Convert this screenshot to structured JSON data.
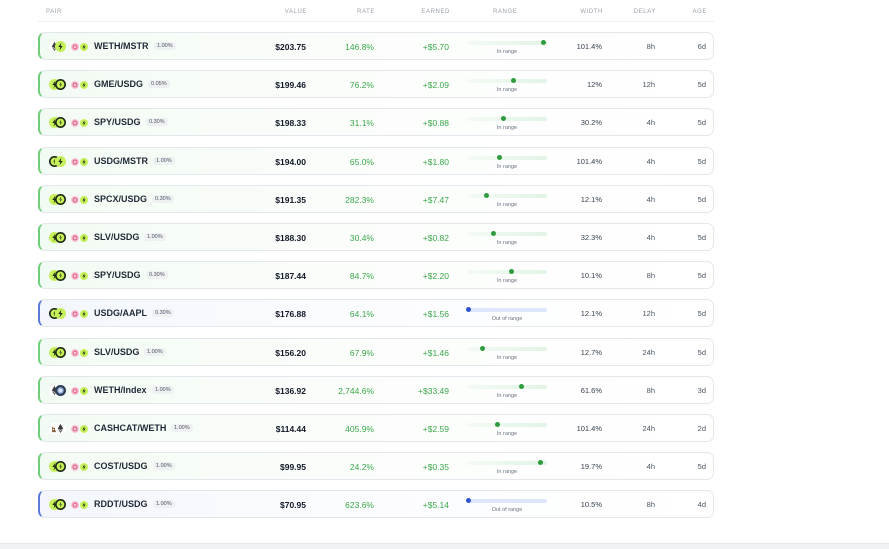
{
  "header": {
    "pair": "PAIR",
    "value": "VALUE",
    "rate": "RATE",
    "earned": "EARNED",
    "range": "RANGE",
    "width": "WIDTH",
    "delay": "DELAY",
    "age": "AGE"
  },
  "colors": {
    "positive": "#3aa84a",
    "in_range_dot": "#2e9b3e",
    "out_range_dot": "#2c55cf",
    "in_range_accent": "#6fcf7a",
    "out_range_accent": "#5b7bd6"
  },
  "positions": [
    {
      "pair": "WETH/MSTR",
      "fee": "1.00%",
      "value": "$203.75",
      "rate": "146.8%",
      "earned": "+$5.70",
      "status": "in",
      "range_label": "In range",
      "range_pos": 0.96,
      "width": "101.4%",
      "delay": "8h",
      "age": "6d",
      "icons": [
        "eth-icon",
        "bolt-icon",
        "pink-token-icon",
        "bolt-icon"
      ]
    },
    {
      "pair": "GME/USDG",
      "fee": "0.05%",
      "value": "$199.46",
      "rate": "76.2%",
      "earned": "+$2.09",
      "status": "in",
      "range_label": "In range",
      "range_pos": 0.58,
      "width": "12%",
      "delay": "12h",
      "age": "5d",
      "icons": [
        "bolt-icon",
        "usdg-icon",
        "pink-token-icon",
        "bolt-icon"
      ]
    },
    {
      "pair": "SPY/USDG",
      "fee": "0.30%",
      "value": "$198.33",
      "rate": "31.1%",
      "earned": "+$0.88",
      "status": "in",
      "range_label": "In range",
      "range_pos": 0.45,
      "width": "30.2%",
      "delay": "4h",
      "age": "5d",
      "icons": [
        "bolt-icon",
        "usdg-icon",
        "pink-token-icon",
        "bolt-icon"
      ]
    },
    {
      "pair": "USDG/MSTR",
      "fee": "1.00%",
      "value": "$194.00",
      "rate": "65.0%",
      "earned": "+$1.80",
      "status": "in",
      "range_label": "In range",
      "range_pos": 0.41,
      "width": "101.4%",
      "delay": "4h",
      "age": "5d",
      "icons": [
        "usdg-icon",
        "bolt-icon",
        "pink-token-icon",
        "bolt-icon"
      ]
    },
    {
      "pair": "SPCX/USDG",
      "fee": "0.30%",
      "value": "$191.35",
      "rate": "282.3%",
      "earned": "+$7.47",
      "status": "in",
      "range_label": "In range",
      "range_pos": 0.24,
      "width": "12.1%",
      "delay": "4h",
      "age": "5d",
      "icons": [
        "bolt-icon",
        "usdg-icon",
        "pink-token-icon",
        "bolt-icon"
      ]
    },
    {
      "pair": "SLV/USDG",
      "fee": "1.00%",
      "value": "$188.30",
      "rate": "30.4%",
      "earned": "+$0.82",
      "status": "in",
      "range_label": "In range",
      "range_pos": 0.33,
      "width": "32.3%",
      "delay": "4h",
      "age": "5d",
      "icons": [
        "bolt-icon",
        "usdg-icon",
        "pink-token-icon",
        "bolt-icon"
      ]
    },
    {
      "pair": "SPY/USDG",
      "fee": "0.30%",
      "value": "$187.44",
      "rate": "84.7%",
      "earned": "+$2.20",
      "status": "in",
      "range_label": "In range",
      "range_pos": 0.55,
      "width": "10.1%",
      "delay": "8h",
      "age": "5d",
      "icons": [
        "bolt-icon",
        "usdg-icon",
        "pink-token-icon",
        "bolt-icon"
      ]
    },
    {
      "pair": "USDG/AAPL",
      "fee": "0.30%",
      "value": "$176.88",
      "rate": "64.1%",
      "earned": "+$1.56",
      "status": "out",
      "range_label": "Out of range",
      "range_pos": 0.02,
      "width": "12.1%",
      "delay": "12h",
      "age": "5d",
      "icons": [
        "usdg-icon",
        "bolt-icon",
        "pink-token-icon",
        "bolt-icon"
      ]
    },
    {
      "pair": "SLV/USDG",
      "fee": "1.00%",
      "value": "$156.20",
      "rate": "67.9%",
      "earned": "+$1.46",
      "status": "in",
      "range_label": "In range",
      "range_pos": 0.19,
      "width": "12.7%",
      "delay": "24h",
      "age": "5d",
      "icons": [
        "bolt-icon",
        "usdg-icon",
        "pink-token-icon",
        "bolt-icon"
      ]
    },
    {
      "pair": "WETH/Index",
      "fee": "1.00%",
      "value": "$136.92",
      "rate": "2,744.6%",
      "earned": "+$33.49",
      "status": "in",
      "range_label": "In range",
      "range_pos": 0.68,
      "width": "61.6%",
      "delay": "8h",
      "age": "3d",
      "icons": [
        "eth-icon",
        "index-icon",
        "pink-token-icon",
        "bolt-icon"
      ]
    },
    {
      "pair": "CASHCAT/WETH",
      "fee": "1.00%",
      "value": "$114.44",
      "rate": "405.9%",
      "earned": "+$2.59",
      "status": "in",
      "range_label": "In range",
      "range_pos": 0.38,
      "width": "101.4%",
      "delay": "24h",
      "age": "2d",
      "icons": [
        "cat-icon",
        "eth-icon",
        "pink-token-icon",
        "bolt-icon"
      ]
    },
    {
      "pair": "COST/USDG",
      "fee": "1.00%",
      "value": "$99.95",
      "rate": "24.2%",
      "earned": "+$0.35",
      "status": "in",
      "range_label": "In range",
      "range_pos": 0.92,
      "width": "19.7%",
      "delay": "4h",
      "age": "5d",
      "icons": [
        "bolt-icon",
        "usdg-icon",
        "pink-token-icon",
        "bolt-icon"
      ]
    },
    {
      "pair": "RDDT/USDG",
      "fee": "1.00%",
      "value": "$70.95",
      "rate": "623.6%",
      "earned": "+$5.14",
      "status": "out",
      "range_label": "Out of range",
      "range_pos": 0.02,
      "width": "10.5%",
      "delay": "8h",
      "age": "4d",
      "icons": [
        "bolt-icon",
        "usdg-icon",
        "pink-token-icon",
        "bolt-icon"
      ]
    }
  ]
}
